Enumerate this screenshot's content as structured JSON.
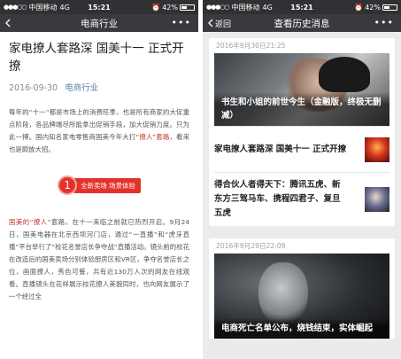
{
  "status_bar": {
    "signal": "●●●○○",
    "carrier": "中国移动",
    "network": "4G",
    "time": "15:21",
    "battery": "42%"
  },
  "left": {
    "nav": {
      "back_label": "",
      "title": "电商行业",
      "more": "•••"
    },
    "article": {
      "title": "家电撩人套路深 国美十一 正式开撩",
      "date": "2016-09-30",
      "account": "电商行业",
      "para1_a": "每年的“十一”都是市场上的消费旺季，也是所有商家的大促重点阶段，各品牌端尽所能拿出促销手段，加大促销力度。只为此一搏。国内知名家电零售商国美今年大打",
      "para1_hl": "“撩人”套路",
      "para1_b": "，看来也是颇放大招。",
      "tag_number": "1",
      "tag_label": "全新卖场 场景体验",
      "para2_hl": "国美的“撩人”",
      "para2": "套路，在十一来临之前就已热烈开启。9月24日，国美电器在北京西坝河门店，通过“一直播”和“虎牙直播”平台举行了“校花名誉店长争夺战”直播活动。镜头前的校花在改造后的国美卖场分别体验厨房区和VR区，争夺名誉店长之位，画面撩人，秀色可餐，共有近130万人次的网友在线观看。直播镜头在花样展示校花撩人美貌同时，也向网友展示了一个经过全"
    }
  },
  "right": {
    "nav": {
      "back_label": "返回",
      "title": "查看历史消息",
      "more": "•••"
    },
    "cards": [
      {
        "date": "2016年9月30日21:25",
        "hero_title": "书生和小姐的前世今生（金融版，终极无删减）",
        "items": [
          {
            "title": "家电撩人套路深 国美十一 正式开撩"
          },
          {
            "title": "得合伙人者得天下：腾讯五虎、新东方三驾马车、携程四君子、复旦五虎"
          }
        ]
      },
      {
        "date": "2016年9月29日22:09",
        "hero_title": "电商死亡名单公布，烧钱结束，实体崛起",
        "items": []
      }
    ]
  },
  "colors": {
    "nav_bg": "#393a3f",
    "status_bg": "#303133",
    "highlight_red": "#c3312c",
    "link_blue": "#5b7fae"
  }
}
